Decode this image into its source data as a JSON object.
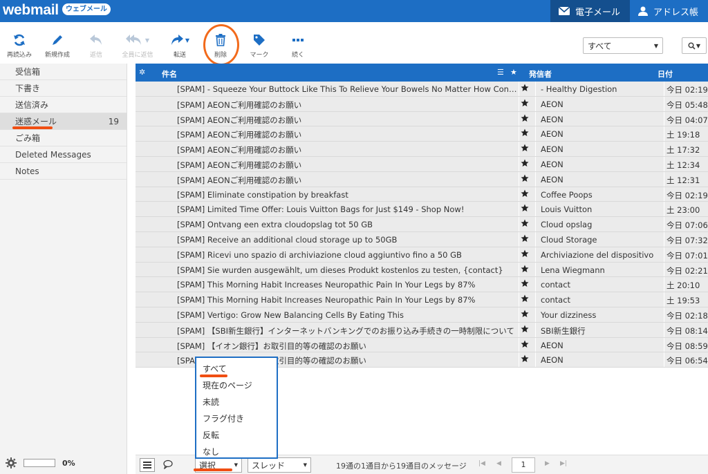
{
  "app": {
    "logo": "webmail",
    "badge": "ウェブメール"
  },
  "topnav": [
    {
      "label": "電子メール",
      "icon": "envelope-icon",
      "active": true
    },
    {
      "label": "アドレス帳",
      "icon": "person-icon",
      "active": false
    }
  ],
  "toolbar": {
    "refresh": "再読込み",
    "compose": "新規作成",
    "reply": "返信",
    "reply_all": "全員に返信",
    "forward": "転送",
    "delete": "削除",
    "mark": "マーク",
    "more": "続く",
    "filter": "すべて"
  },
  "folders": [
    {
      "name": "受信箱",
      "count": ""
    },
    {
      "name": "下書き",
      "count": ""
    },
    {
      "name": "送信済み",
      "count": ""
    },
    {
      "name": "迷惑メール",
      "count": "19",
      "active": true
    },
    {
      "name": "ごみ箱",
      "count": ""
    },
    {
      "name": "Deleted Messages",
      "count": ""
    },
    {
      "name": "Notes",
      "count": ""
    }
  ],
  "quota": "0%",
  "list_header": {
    "subject": "件名",
    "sender": "発信者",
    "date": "日付"
  },
  "messages": [
    {
      "subject": "[SPAM] - Squeeze Your Buttock Like This To Relieve Your Bowels No Matter How Constipated...",
      "sender": "- Healthy Digestion",
      "date": "今日 02:19"
    },
    {
      "subject": "[SPAM] AEONご利用確認のお願い",
      "sender": "AEON",
      "date": "今日 05:48"
    },
    {
      "subject": "[SPAM] AEONご利用確認のお願い",
      "sender": "AEON",
      "date": "今日 04:07"
    },
    {
      "subject": "[SPAM] AEONご利用確認のお願い",
      "sender": "AEON",
      "date": "土 19:18"
    },
    {
      "subject": "[SPAM] AEONご利用確認のお願い",
      "sender": "AEON",
      "date": "土 17:32"
    },
    {
      "subject": "[SPAM] AEONご利用確認のお願い",
      "sender": "AEON",
      "date": "土 12:34"
    },
    {
      "subject": "[SPAM] AEONご利用確認のお願い",
      "sender": "AEON",
      "date": "土 12:31"
    },
    {
      "subject": "[SPAM] Eliminate constipation by breakfast",
      "sender": "Coffee Poops",
      "date": "今日 02:19"
    },
    {
      "subject": "[SPAM] Limited Time Offer: Louis Vuitton Bags for Just $149 - Shop Now!",
      "sender": "Louis Vuitton",
      "date": "土 23:00"
    },
    {
      "subject": "[SPAM] Ontvang een extra cloudopslag tot 50 GB",
      "sender": "Cloud opslag",
      "date": "今日 07:06"
    },
    {
      "subject": "[SPAM] Receive an additional cloud storage up to 50GB",
      "sender": "Cloud Storage",
      "date": "今日 07:32"
    },
    {
      "subject": "[SPAM] Ricevi uno spazio di archiviazione cloud aggiuntivo fino a 50 GB",
      "sender": "Archiviazione del dispositivo",
      "date": "今日 07:01"
    },
    {
      "subject": "[SPAM] Sie wurden ausgewählt, um dieses Produkt kostenlos zu testen, {contact}",
      "sender": "Lena Wiegmann",
      "date": "今日 02:21"
    },
    {
      "subject": "[SPAM] This Morning Habit Increases Neuropathic Pain In Your Legs by 87%",
      "sender": "contact",
      "date": "土 20:10"
    },
    {
      "subject": "[SPAM] This Morning Habit Increases Neuropathic Pain In Your Legs by 87%",
      "sender": "contact",
      "date": "土 19:53"
    },
    {
      "subject": "[SPAM] Vertigo: Grow New Balancing Cells By Eating This",
      "sender": "Your dizziness",
      "date": "今日 02:18"
    },
    {
      "subject": "[SPAM] 【SBI新生銀行】インターネットバンキングでのお振り込み手続きの一時制限について",
      "sender": "SBI新生銀行",
      "date": "今日 08:14"
    },
    {
      "subject": "[SPAM] 【イオン銀行】お取引目的等の確認のお願い",
      "sender": "AEON",
      "date": "今日 08:59"
    },
    {
      "subject": "[SPAM] 【イオン銀行】お取引目的等の確認のお願い",
      "sender": "AEON",
      "date": "今日 06:54"
    }
  ],
  "footer": {
    "select": "選択",
    "thread": "スレッド",
    "count_text": "19通の1通目から19通目のメッセージ",
    "page": "1"
  },
  "dropdown": [
    "すべて",
    "現在のページ",
    "未読",
    "フラグ付き",
    "反転",
    "なし"
  ]
}
